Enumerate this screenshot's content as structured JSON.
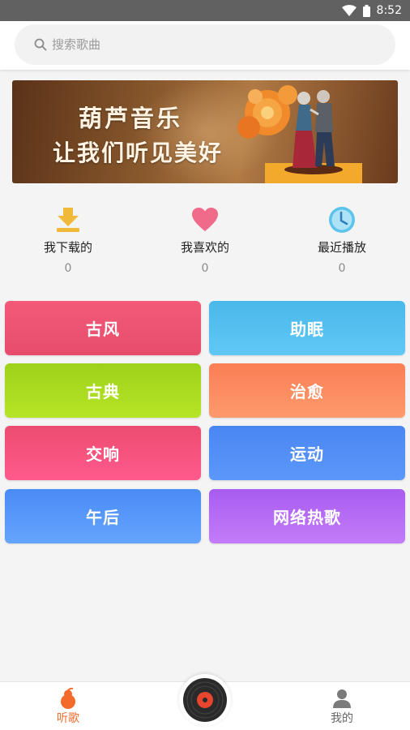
{
  "status_bar": {
    "time": "8:52"
  },
  "search": {
    "placeholder": "搜索歌曲",
    "value": ""
  },
  "banner": {
    "title": "葫芦音乐",
    "subtitle": "让我们听见美好"
  },
  "quick_stats": [
    {
      "label": "我下载的",
      "count": "0",
      "icon": "download-icon",
      "color": "#f0b93a"
    },
    {
      "label": "我喜欢的",
      "count": "0",
      "icon": "heart-icon",
      "color": "#f06a8a"
    },
    {
      "label": "最近播放",
      "count": "0",
      "icon": "clock-icon",
      "color": "#5cc3ec"
    }
  ],
  "genres": [
    {
      "label": "古风",
      "gradient": [
        "#f25a78",
        "#e84c6c"
      ]
    },
    {
      "label": "助眠",
      "gradient": [
        "#4ab8ea",
        "#60c8f6"
      ]
    },
    {
      "label": "古典",
      "gradient": [
        "#9ed21a",
        "#b6e426"
      ]
    },
    {
      "label": "治愈",
      "gradient": [
        "#fb7e55",
        "#fd9a6c"
      ]
    },
    {
      "label": "交响",
      "gradient": [
        "#ec4c70",
        "#ff5a8c"
      ]
    },
    {
      "label": "运动",
      "gradient": [
        "#4a86f2",
        "#5b98fa"
      ]
    },
    {
      "label": "午后",
      "gradient": [
        "#4a8cf6",
        "#64a4fc"
      ]
    },
    {
      "label": "网络热歌",
      "gradient": [
        "#a85cf0",
        "#c37cf8"
      ]
    }
  ],
  "bottom_nav": {
    "listen_label": "听歌",
    "mine_label": "我的",
    "active_color": "#f36a2a",
    "inactive_color": "#666666"
  }
}
